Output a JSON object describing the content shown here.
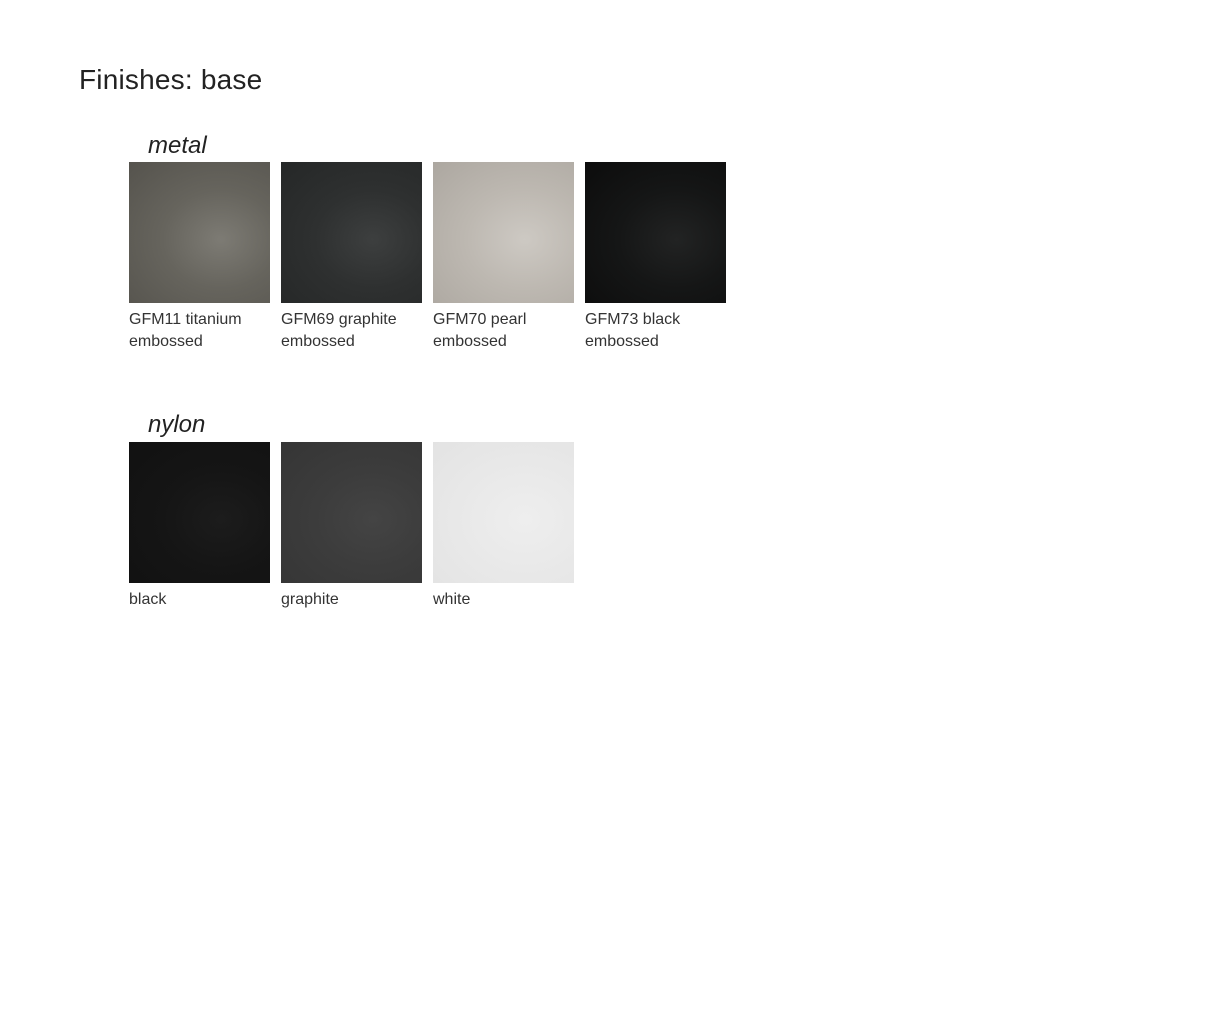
{
  "page": {
    "title": "Finishes: base"
  },
  "groups": [
    {
      "name": "metal",
      "items": [
        {
          "label": "GFM11 titanium\nembossed",
          "color": "#66645d",
          "highlight": "#7d7b74",
          "shade": "#55534d"
        },
        {
          "label": "GFM69 graphite\nembossed",
          "color": "#2e3030",
          "highlight": "#3d3f3f",
          "shade": "#252727"
        },
        {
          "label": "GFM70 pearl\nembossed",
          "color": "#bdb8b1",
          "highlight": "#cdc9c3",
          "shade": "#aca7a0"
        },
        {
          "label": "GFM73 black\nembossed",
          "color": "#151616",
          "highlight": "#222323",
          "shade": "#0c0c0c"
        }
      ]
    },
    {
      "name": "nylon",
      "items": [
        {
          "label": "black",
          "color": "#151515",
          "highlight": "#1c1c1c",
          "shade": "#111111"
        },
        {
          "label": "graphite",
          "color": "#3c3c3c",
          "highlight": "#444444",
          "shade": "#353535"
        },
        {
          "label": "white",
          "color": "#e9e9e9",
          "highlight": "#eeeeee",
          "shade": "#e3e3e3"
        }
      ]
    }
  ]
}
